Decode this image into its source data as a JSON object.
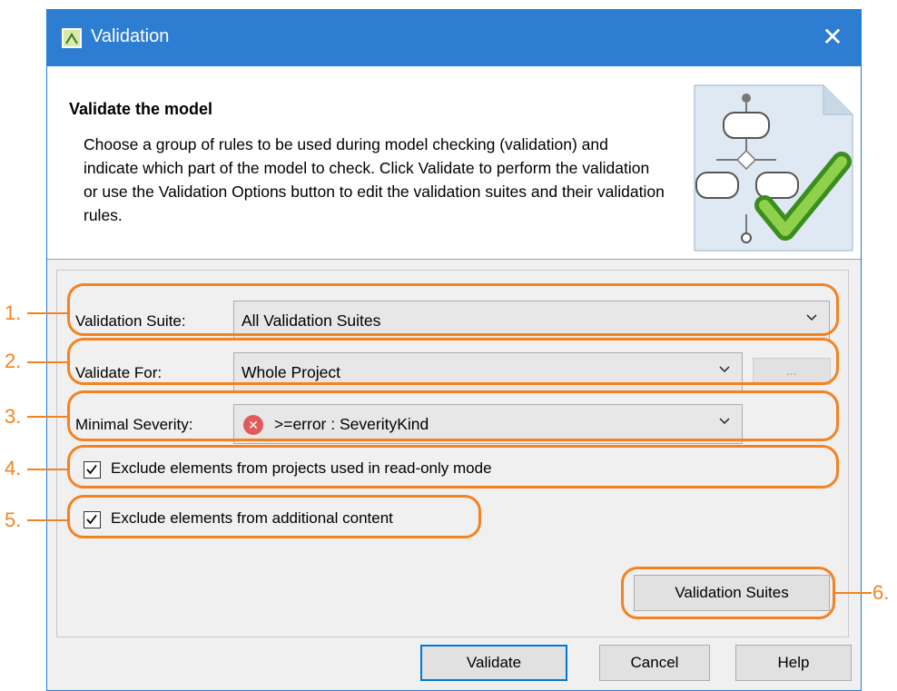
{
  "window": {
    "title": "Validation",
    "close_glyph": "✕"
  },
  "header": {
    "title": "Validate the model",
    "description": "Choose a group of rules to be used during model checking (validation) and indicate which part of the model to check. Click Validate to perform the validation or use the Validation Options button to edit the validation suites and their validation rules."
  },
  "form": {
    "suite_label": "Validation Suite:",
    "suite_value": "All Validation Suites",
    "validate_for_label": "Validate For:",
    "validate_for_value": "Whole Project",
    "ellipsis_label": "...",
    "severity_label": "Minimal Severity:",
    "severity_value": ">=error : SeverityKind",
    "severity_icon": "error-icon",
    "exclude_readonly_label": "Exclude elements from projects used in read-only mode",
    "exclude_readonly_checked": true,
    "exclude_additional_label": "Exclude elements from additional content",
    "exclude_additional_checked": true,
    "validation_suites_button": "Validation Suites"
  },
  "footer": {
    "validate_button": "Validate",
    "cancel_button": "Cancel",
    "help_button": "Help"
  },
  "callouts": [
    "1.",
    "2.",
    "3.",
    "4.",
    "5.",
    "6."
  ],
  "colors": {
    "titlebar": "#2d7dd2",
    "callout": "#f58220",
    "default_button_border": "#0078d7"
  }
}
